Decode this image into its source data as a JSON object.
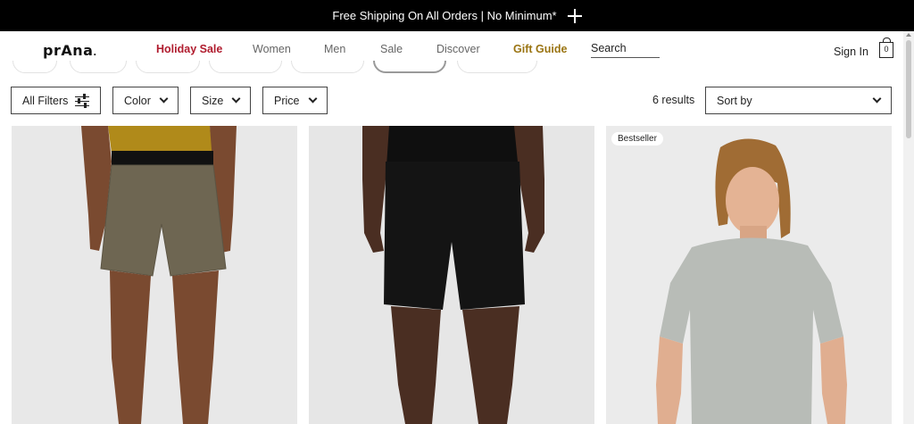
{
  "promo": {
    "text": "Free Shipping On All Orders | No Minimum*"
  },
  "header": {
    "logo": "prAna",
    "nav": [
      {
        "label": "Holiday Sale"
      },
      {
        "label": "Women"
      },
      {
        "label": "Men"
      },
      {
        "label": "Sale"
      },
      {
        "label": "Discover"
      },
      {
        "label": "Gift Guide"
      }
    ],
    "search_label": "Search",
    "sign_in": "Sign In",
    "cart_count": "0"
  },
  "filters": {
    "all_filters": "All Filters",
    "color": "Color",
    "size": "Size",
    "price": "Price",
    "results": "6 results",
    "sort_by": "Sort by"
  },
  "products": [
    {
      "badge": ""
    },
    {
      "badge": ""
    },
    {
      "badge": "Bestseller"
    }
  ],
  "colors": {
    "holiday_sale": "#b01c2e",
    "gift_guide": "#9a7412",
    "promo_bg": "#000000"
  }
}
